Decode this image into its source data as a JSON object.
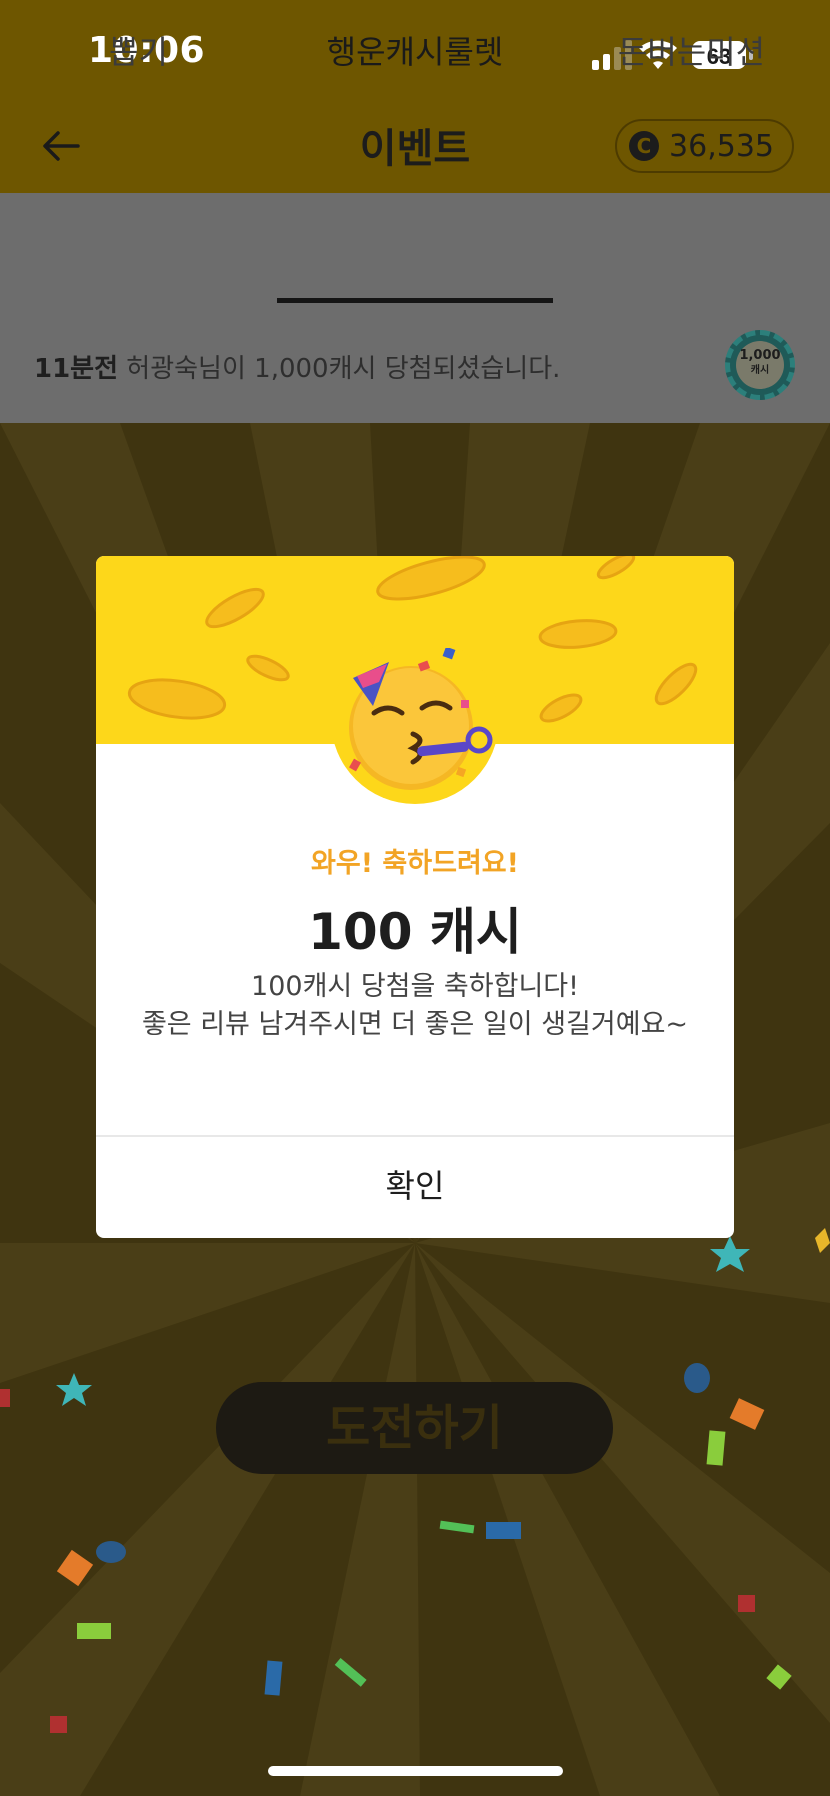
{
  "status_bar": {
    "time": "10:06",
    "battery": "63"
  },
  "header": {
    "title": "이벤트",
    "cash_amount": "36,535",
    "cash_symbol": "C"
  },
  "tabs": [
    {
      "label": "뽑기",
      "active": false
    },
    {
      "label": "행운캐시룰렛",
      "active": true
    },
    {
      "label": "돈버는미션",
      "active": false
    }
  ],
  "ticker": {
    "time_ago": "11분전",
    "message": "허광숙님이 1,000캐시 당첨되셨습니다.",
    "chip_value": "1,000",
    "chip_unit": "캐시"
  },
  "dialog": {
    "subtitle": "와우! 축하드려요!",
    "amount": "100 캐시",
    "message_line1": "100캐시 당첨을 축하합니다!",
    "message_line2": "좋은 리뷰 남겨주시면 더 좋은 일이 생길거예요~",
    "confirm_label": "확인"
  },
  "challenge_button": "도전하기",
  "colors": {
    "accent_yellow": "#fdd71a",
    "subtitle_orange": "#f2a425",
    "header_bg": "#6e5600"
  }
}
